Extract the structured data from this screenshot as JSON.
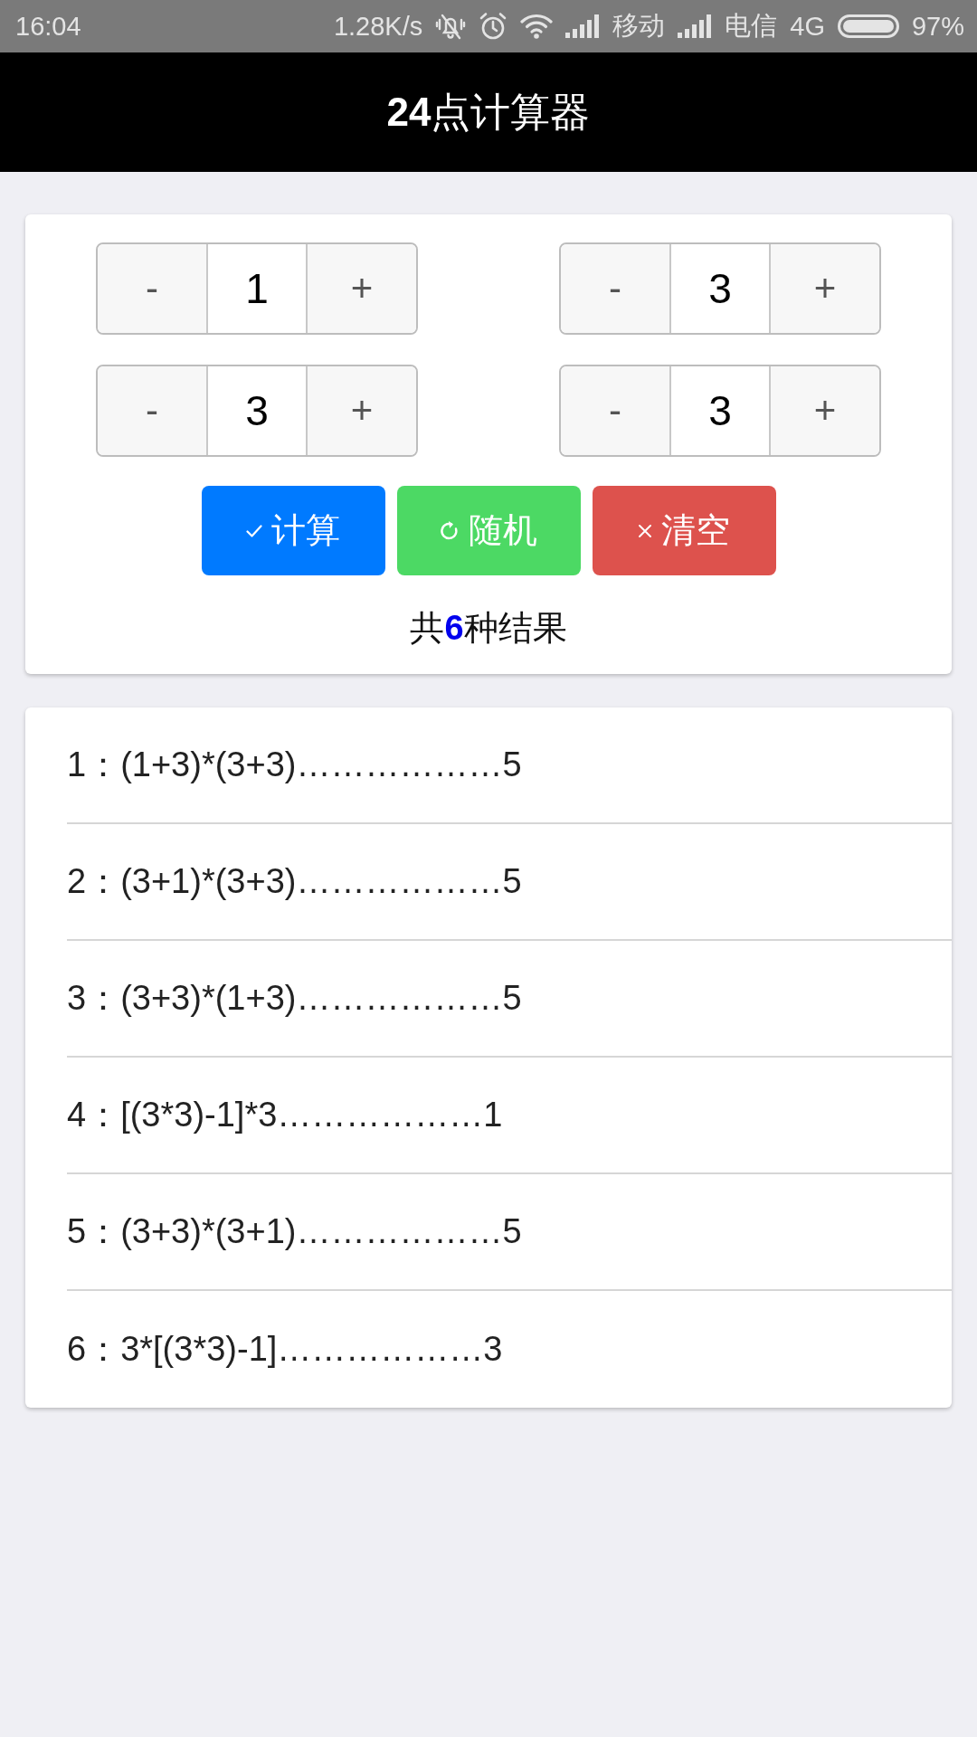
{
  "status_bar": {
    "time": "16:04",
    "speed": "1.28K/s",
    "carrier_1": "移动",
    "carrier_2": "电信",
    "network": "4G",
    "battery": "97%"
  },
  "header": {
    "title": "**24**点计算器"
  },
  "steppers": [
    {
      "minus": "-",
      "value": "1",
      "plus": "+"
    },
    {
      "minus": "-",
      "value": "3",
      "plus": "+"
    },
    {
      "minus": "-",
      "value": "3",
      "plus": "+"
    },
    {
      "minus": "-",
      "value": "3",
      "plus": "+"
    }
  ],
  "actions": [
    {
      "kind": "calculate",
      "label": "计算"
    },
    {
      "kind": "random",
      "label": "随机"
    },
    {
      "kind": "clear",
      "label": "清空"
    }
  ],
  "summary": "共**6**种结果",
  "results": [
    "1：(1+3)*(3+3)………………5",
    "2：(3+1)*(3+3)………………5",
    "3：(3+3)*(1+3)………………5",
    "4：[(3*3)-1]*3………………1",
    "5：(3+3)*(3+1)………………5",
    "6：3*[(3*3)-1]………………3"
  ]
}
